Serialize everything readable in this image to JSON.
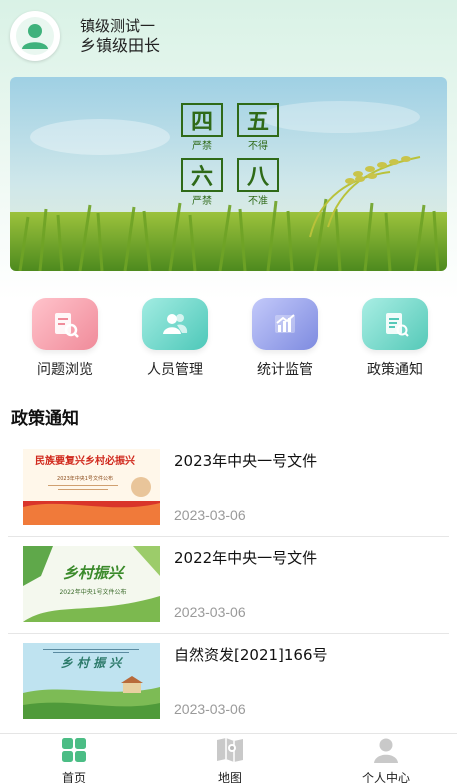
{
  "user": {
    "name": "镇级测试一",
    "role": "乡镇级田长",
    "avatar_icon": "person-avatar-icon"
  },
  "banner": {
    "slogan": [
      {
        "big": "四",
        "small": "严禁"
      },
      {
        "big": "五",
        "small": "不得"
      },
      {
        "big": "六",
        "small": "严禁"
      },
      {
        "big": "八",
        "small": "不准"
      }
    ]
  },
  "quick_actions": [
    {
      "label": "问题浏览",
      "icon": "document-search-icon",
      "color": "#f49aa7"
    },
    {
      "label": "人员管理",
      "icon": "people-icon",
      "color": "#69d3c8"
    },
    {
      "label": "统计监管",
      "icon": "bar-chart-icon",
      "color": "#9ba6ee"
    },
    {
      "label": "政策通知",
      "icon": "notice-doc-icon",
      "color": "#76d5c8"
    }
  ],
  "policy_section": {
    "title": "政策通知",
    "items": [
      {
        "title": "2023年中央一号文件",
        "date": "2023-03-06",
        "thumb_text": "民族要复兴乡村必振兴",
        "thumb_sub": "2023年中央1号文件公布"
      },
      {
        "title": "2022年中央一号文件",
        "date": "2023-03-06",
        "thumb_text": "乡村振兴",
        "thumb_sub": "2022年中央1号文件公布"
      },
      {
        "title": "自然资发[2021]166号",
        "date": "2023-03-06",
        "thumb_text": "乡 村 振 兴",
        "thumb_sub": ""
      }
    ]
  },
  "bottom_nav": [
    {
      "label": "首页",
      "icon": "home-grid-icon",
      "active": true
    },
    {
      "label": "地图",
      "icon": "map-icon",
      "active": false
    },
    {
      "label": "个人中心",
      "icon": "user-icon",
      "active": false
    }
  ],
  "colors": {
    "accent": "#4bbd85",
    "inactive": "#b9b9b9"
  }
}
